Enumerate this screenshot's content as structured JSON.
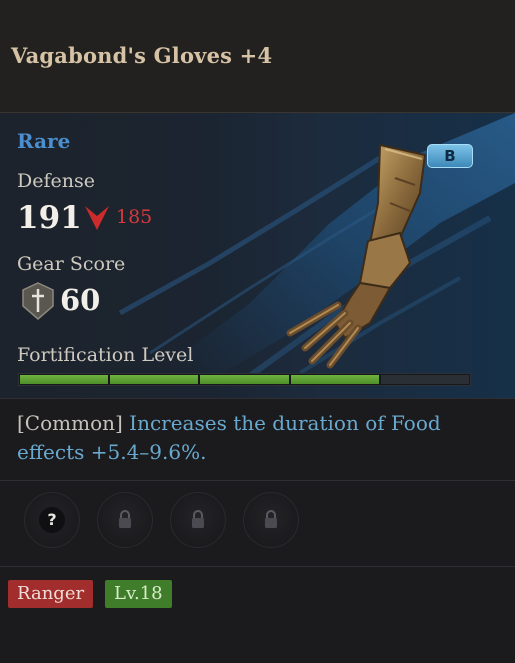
{
  "item": {
    "name": "Vagabond's Gloves +4",
    "rarity": "Rare",
    "grade_badge": "B",
    "rarity_color": "#4b8fd0"
  },
  "stats": {
    "defense_label": "Defense",
    "defense_value": "191",
    "defense_compare_value": "185",
    "defense_compare_icon": "red-down-arrow-icon",
    "gear_score_label": "Gear Score",
    "gear_score_icon": "sword-shield-icon",
    "gear_score_value": "60"
  },
  "fortification": {
    "label": "Fortification Level",
    "filled_segments": 4,
    "total_segments": 5
  },
  "trait": {
    "tier": "[Common]",
    "description": "Increases the duration of Food effects +5.4–9.6%."
  },
  "sockets": [
    {
      "icon": "question-icon",
      "glyph": "?"
    },
    {
      "icon": "lock-icon"
    },
    {
      "icon": "lock-icon"
    },
    {
      "icon": "lock-icon"
    }
  ],
  "tags": {
    "class": "Ranger",
    "level": "Lv.18"
  },
  "colors": {
    "filled_bar": "#5ba033",
    "class_tag": "#a22d2d",
    "level_tag": "#3f7d2a",
    "compare_down": "#d63a3a"
  }
}
